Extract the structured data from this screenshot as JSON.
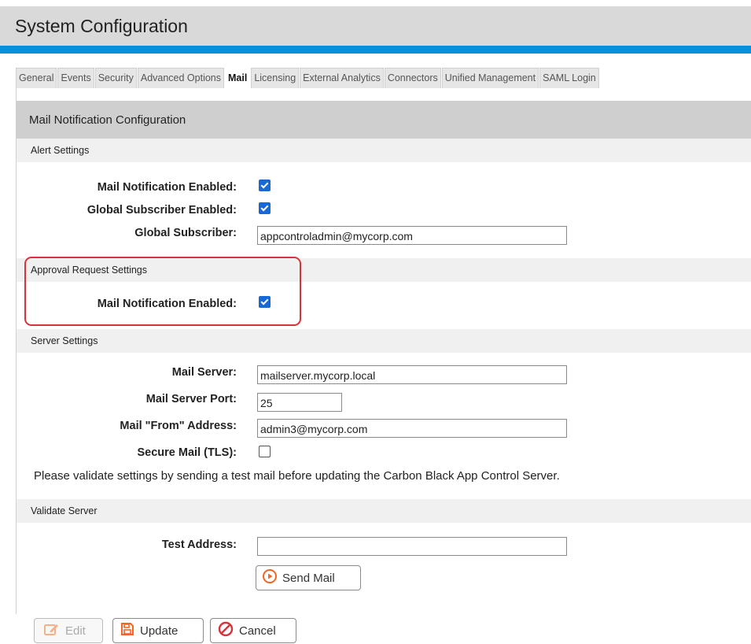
{
  "page": {
    "title": "System Configuration"
  },
  "tabs": [
    "General",
    "Events",
    "Security",
    "Advanced Options",
    "Mail",
    "Licensing",
    "External Analytics",
    "Connectors",
    "Unified Management",
    "SAML Login"
  ],
  "active_tab": "Mail",
  "panel": {
    "title": "Mail Notification Configuration"
  },
  "alert_settings": {
    "header": "Alert Settings",
    "mail_notification_label": "Mail Notification Enabled:",
    "mail_notification_checked": true,
    "global_subscriber_enabled_label": "Global Subscriber Enabled:",
    "global_subscriber_enabled_checked": true,
    "global_subscriber_label": "Global Subscriber:",
    "global_subscriber_value": "appcontroladmin@mycorp.com"
  },
  "approval_settings": {
    "header": "Approval Request Settings",
    "mail_notification_label": "Mail Notification Enabled:",
    "mail_notification_checked": true
  },
  "server_settings": {
    "header": "Server Settings",
    "mail_server_label": "Mail Server:",
    "mail_server_value": "mailserver.mycorp.local",
    "port_label": "Mail Server Port:",
    "port_value": "25",
    "from_label": "Mail \"From\" Address:",
    "from_value": "admin3@mycorp.com",
    "tls_label": "Secure Mail (TLS):",
    "tls_checked": false,
    "note": "Please validate settings by sending a test mail before updating the Carbon Black App Control Server."
  },
  "validate_server": {
    "header": "Validate Server",
    "test_address_label": "Test Address:",
    "test_address_value": "",
    "send_mail_label": "Send Mail"
  },
  "footer": {
    "edit_label": "Edit",
    "update_label": "Update",
    "cancel_label": "Cancel"
  },
  "colors": {
    "accent_blue": "#0a8fd9",
    "highlight_red": "#d8333b",
    "icon_orange": "#f26522",
    "cancel_red": "#d8333b"
  }
}
